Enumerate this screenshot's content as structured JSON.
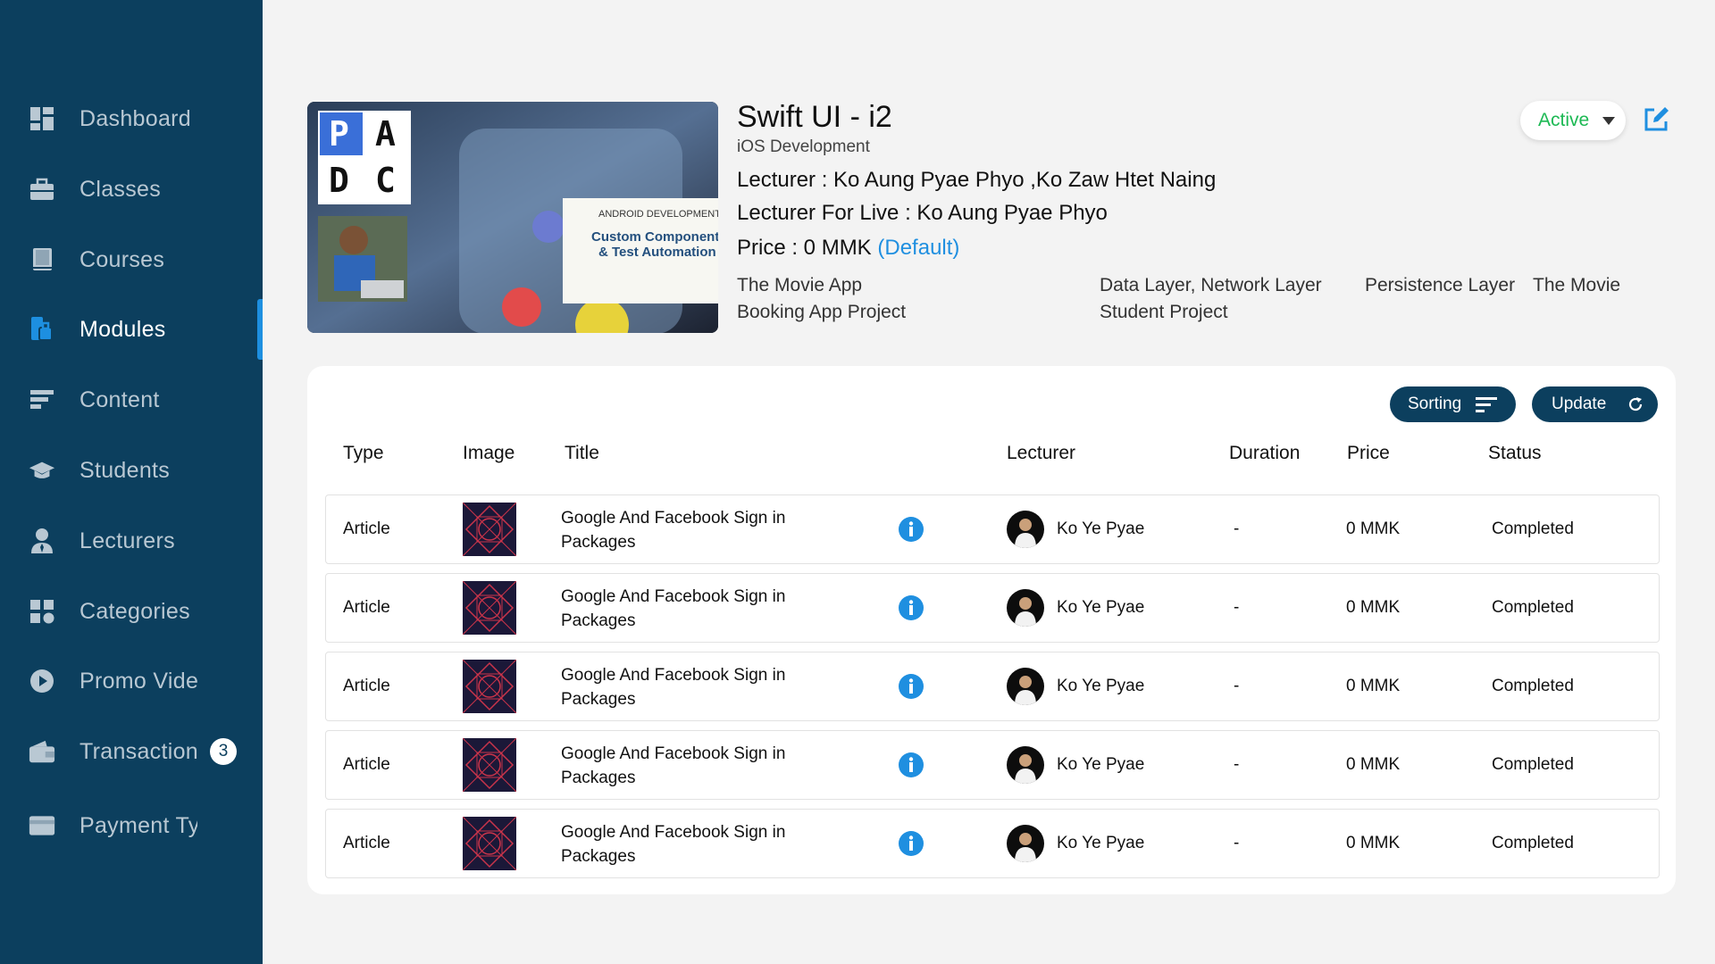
{
  "sidebar": {
    "items": [
      {
        "label": "Dashboard",
        "icon": "dashboard-icon"
      },
      {
        "label": "Classes",
        "icon": "briefcase-icon"
      },
      {
        "label": "Courses",
        "icon": "book-icon"
      },
      {
        "label": "Modules",
        "icon": "modules-icon"
      },
      {
        "label": "Content",
        "icon": "content-icon"
      },
      {
        "label": "Students",
        "icon": "graduation-cap-icon"
      },
      {
        "label": "Lecturers",
        "icon": "lecturer-icon"
      },
      {
        "label": "Categories",
        "icon": "categories-icon"
      },
      {
        "label": "Promo Videos",
        "icon": "play-icon"
      },
      {
        "label": "Transactions",
        "icon": "wallet-icon",
        "badge": "3"
      },
      {
        "label": "Payment Types",
        "icon": "card-icon"
      }
    ],
    "active": "Modules"
  },
  "course": {
    "cover_text": {
      "letters": [
        "P",
        "A",
        "D",
        "C"
      ],
      "banner_top": "ANDROID DEVELOPMENT",
      "banner_line1": "Custom Components",
      "banner_line2": "& Test Automation"
    },
    "title": "Swift UI - i2",
    "category": "iOS Development",
    "lecturer": "Lecturer : Ko Aung Pyae Phyo ,Ko Zaw Htet Naing",
    "lecturer_live": "Lecturer For Live : Ko Aung Pyae Phyo",
    "price": "Price : 0 MMK",
    "price_default": "(Default)",
    "tags": [
      "The Movie App Booking App Project",
      "Data Layer, Network Layer Student Project",
      "Persistence Layer",
      "The Movie"
    ],
    "status": "Active"
  },
  "toolbar": {
    "sorting_label": "Sorting",
    "update_label": "Update"
  },
  "table": {
    "headers": [
      "Type",
      "Image",
      "Title",
      "Lecturer",
      "Duration",
      "Price",
      "Status"
    ],
    "rows": [
      {
        "type": "Article",
        "title": "Google And Facebook Sign in Packages",
        "lecturer": "Ko Ye Pyae",
        "duration": "-",
        "price": "0 MMK",
        "status": "Completed"
      },
      {
        "type": "Article",
        "title": "Google And Facebook Sign in Packages",
        "lecturer": "Ko Ye Pyae",
        "duration": "-",
        "price": "0 MMK",
        "status": "Completed"
      },
      {
        "type": "Article",
        "title": "Google And Facebook Sign in Packages",
        "lecturer": "Ko Ye Pyae",
        "duration": "-",
        "price": "0 MMK",
        "status": "Completed"
      },
      {
        "type": "Article",
        "title": "Google And Facebook Sign in Packages",
        "lecturer": "Ko Ye Pyae",
        "duration": "-",
        "price": "0 MMK",
        "status": "Completed"
      },
      {
        "type": "Article",
        "title": "Google And Facebook Sign in Packages",
        "lecturer": "Ko Ye Pyae",
        "duration": "-",
        "price": "0 MMK",
        "status": "Completed"
      }
    ]
  },
  "colors": {
    "sidebar": "#0c3f5e",
    "accent": "#1f8fe0",
    "active_status": "#1db954"
  }
}
